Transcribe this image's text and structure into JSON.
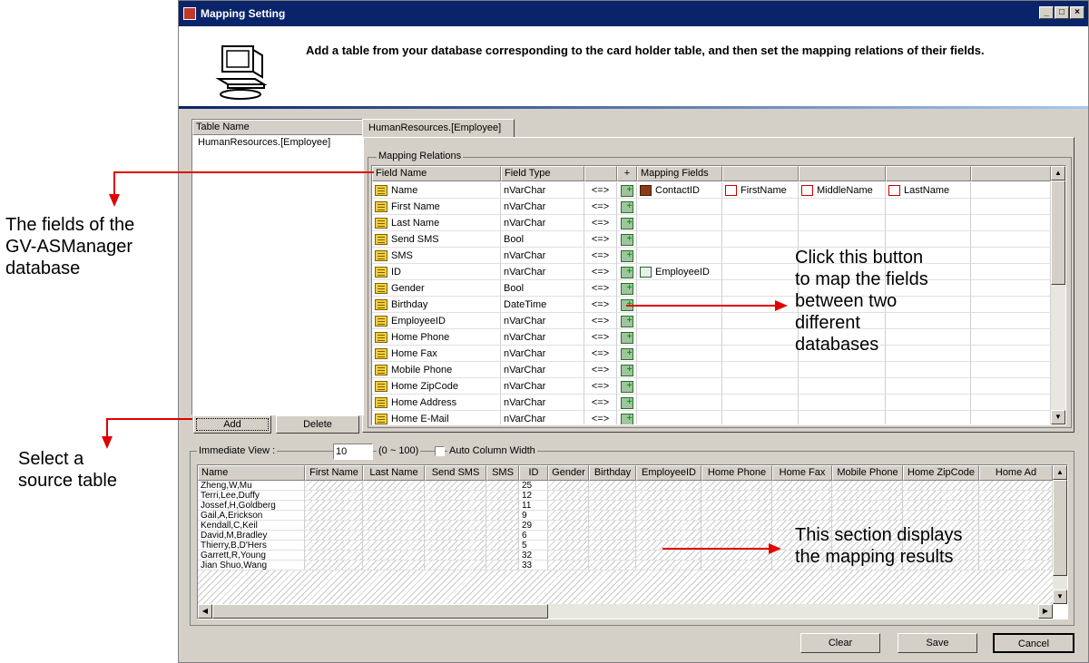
{
  "window": {
    "title": "Mapping Setting",
    "controls": [
      "_",
      "□",
      "×"
    ]
  },
  "header": {
    "description": "Add a table from your database corresponding to the card holder table, and then set the mapping relations of their fields."
  },
  "table_list": {
    "header": "Table Name",
    "items": [
      "HumanResources.[Employee]"
    ],
    "add_label": "Add",
    "delete_label": "Delete"
  },
  "tab": {
    "label": "HumanResources.[Employee]"
  },
  "mapping": {
    "group_label": "Mapping Relations",
    "headers": {
      "field_name": "Field Name",
      "field_type": "Field Type",
      "arrow": "",
      "plus": "+",
      "mapping_fields": "Mapping Fields"
    },
    "rows": [
      {
        "name": "Name",
        "type": "nVarChar",
        "arrow": "<=>",
        "maps": [
          "ContactID",
          "FirstName",
          "MiddleName",
          "LastName"
        ]
      },
      {
        "name": "First Name",
        "type": "nVarChar",
        "arrow": "<=>",
        "maps": []
      },
      {
        "name": "Last Name",
        "type": "nVarChar",
        "arrow": "<=>",
        "maps": []
      },
      {
        "name": "Send SMS",
        "type": "Bool",
        "arrow": "<=>",
        "maps": []
      },
      {
        "name": "SMS",
        "type": "nVarChar",
        "arrow": "<=>",
        "maps": []
      },
      {
        "name": "ID",
        "type": "nVarChar",
        "arrow": "<=>",
        "maps": [
          "EmployeeID"
        ]
      },
      {
        "name": "Gender",
        "type": "Bool",
        "arrow": "<=>",
        "maps": []
      },
      {
        "name": "Birthday",
        "type": "DateTime",
        "arrow": "<=>",
        "maps": []
      },
      {
        "name": "EmployeeID",
        "type": "nVarChar",
        "arrow": "<=>",
        "maps": []
      },
      {
        "name": "Home Phone",
        "type": "nVarChar",
        "arrow": "<=>",
        "maps": []
      },
      {
        "name": "Home Fax",
        "type": "nVarChar",
        "arrow": "<=>",
        "maps": []
      },
      {
        "name": "Mobile Phone",
        "type": "nVarChar",
        "arrow": "<=>",
        "maps": []
      },
      {
        "name": "Home ZipCode",
        "type": "nVarChar",
        "arrow": "<=>",
        "maps": []
      },
      {
        "name": "Home Address",
        "type": "nVarChar",
        "arrow": "<=>",
        "maps": []
      },
      {
        "name": "Home E-Mail",
        "type": "nVarChar",
        "arrow": "<=>",
        "maps": []
      }
    ]
  },
  "immediate": {
    "label": "Immediate View :",
    "value": "10",
    "range": "(0 ~ 100)",
    "auto_width_label": "Auto Column Width",
    "columns": [
      "Name",
      "First Name",
      "Last Name",
      "Send SMS",
      "SMS",
      "ID",
      "Gender",
      "Birthday",
      "EmployeeID",
      "Home Phone",
      "Home Fax",
      "Mobile Phone",
      "Home ZipCode",
      "Home Ad"
    ],
    "rows": [
      {
        "name": "Zheng,W,Mu",
        "id": "25"
      },
      {
        "name": "Terri,Lee,Duffy",
        "id": "12"
      },
      {
        "name": "Jossef,H,Goldberg",
        "id": "11"
      },
      {
        "name": "Gail,A,Erickson",
        "id": "9"
      },
      {
        "name": "Kendall,C,Keil",
        "id": "29"
      },
      {
        "name": "David,M,Bradley",
        "id": "6"
      },
      {
        "name": "Thierry,B,D'Hers",
        "id": "5"
      },
      {
        "name": "Garrett,R,Young",
        "id": "32"
      },
      {
        "name": "Jian Shuo,Wang",
        "id": "33"
      }
    ]
  },
  "footer": {
    "clear_label": "Clear",
    "save_label": "Save",
    "cancel_label": "Cancel"
  },
  "annotations": {
    "fields_db": [
      "The fields of the",
      "GV-ASManager",
      "database"
    ],
    "select_source": [
      "Select a",
      "source table"
    ],
    "click_button": [
      "Click this button",
      "to map the fields",
      "between two",
      "different",
      "databases"
    ],
    "results": [
      "This section displays",
      "the mapping results"
    ]
  },
  "colors": {
    "titlebar": "#0a246a",
    "arrow": "#e00000",
    "dialog": "#d4d0c8"
  }
}
